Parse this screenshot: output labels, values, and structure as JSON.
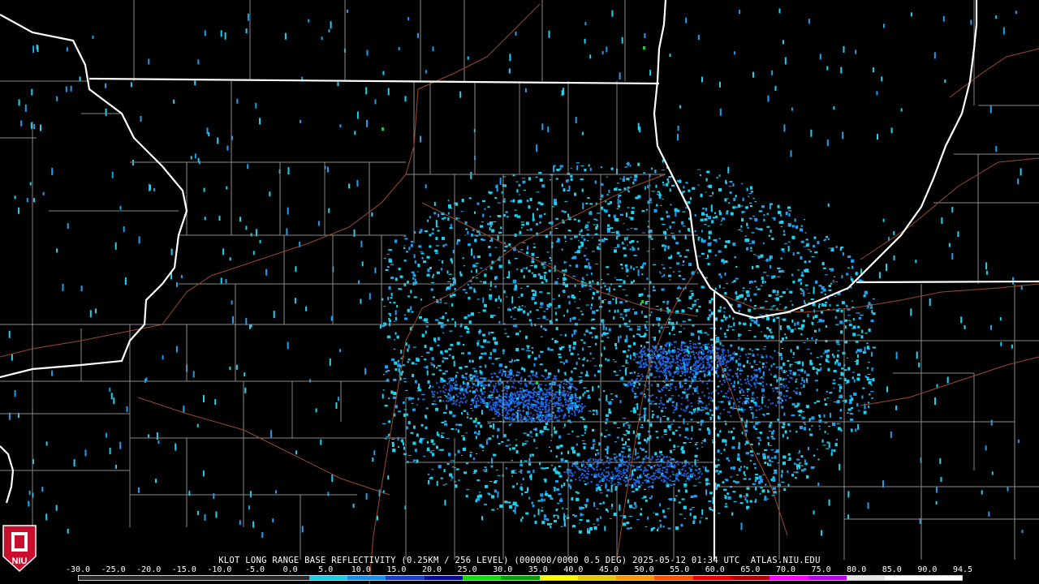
{
  "header": {
    "text": "KLOT LONG RANGE BASE REFLECTIVITY (0.25KM / 256 LEVEL) (000000/0000 0.5 DEG) 2025-05-12 01:34 UTC  ATLAS.NIU.EDU"
  },
  "logo": {
    "text": "NIU",
    "color": "#c8102e"
  },
  "scale": {
    "labels": [
      "-30.0",
      "-25.0",
      "-20.0",
      "-15.0",
      "-10.0",
      "-5.0",
      "0.0",
      "5.0",
      "10.0",
      "15.0",
      "20.0",
      "25.0",
      "30.0",
      "35.0",
      "40.0",
      "45.0",
      "50.0",
      "55.0",
      "60.0",
      "65.0",
      "70.0",
      "75.0",
      "80.0",
      "85.0",
      "90.0",
      "94.5"
    ],
    "colors": [
      "#2a2a2a",
      "#2a2a2a",
      "#2a2a2a",
      "#2a2a2a",
      "#2a2a2a",
      "#2a2a2a",
      "#1ec8e6",
      "#1e8ce6",
      "#1e3cc8",
      "#0a0a96",
      "#14dc14",
      "#0aa00a",
      "#fafa00",
      "#e6c800",
      "#fa9600",
      "#fa5000",
      "#e60000",
      "#b40000",
      "#ff00ff",
      "#b400e6",
      "#e6e6e6",
      "#ffffff",
      "#ffffff"
    ]
  },
  "map_style": {
    "state_border": "#ffffff",
    "county_border": "#8a8a8a",
    "highway": "#9c4a28",
    "echo_colors": [
      "#1ed2f0",
      "#1ea0f0",
      "#2064e6",
      "#22c83c"
    ]
  },
  "radar": {
    "center_fraction": [
      0.56,
      0.62
    ]
  }
}
